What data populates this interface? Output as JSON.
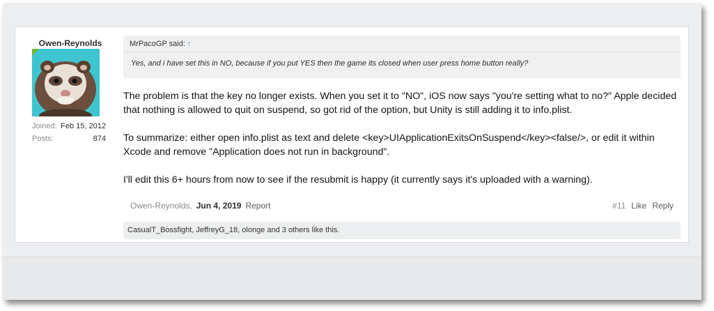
{
  "author": {
    "username": "Owen-Reynolds",
    "joined_label": "Joined:",
    "joined_value": "Feb 15, 2012",
    "posts_label": "Posts:",
    "posts_value": "874"
  },
  "quote": {
    "attribution": "MrPacoGP said:",
    "up_arrow": "↑",
    "text": "Yes, and i have set this in NO, because if you put YES then the game its closed when user press home button really?"
  },
  "message": {
    "paragraphs": [
      "The problem is that the key no longer exists. When you set it to \"NO\", iOS now says \"you're setting what to no?\" Apple decided that nothing is allowed to quit on suspend, so got rid of the option, but Unity is still adding it to info.plist.",
      "To summarize: either open info.plist as text and delete <key>UIApplicationExitsOnSuspend</key><false/>, or edit it within Xcode and remove \"Application does not run in background\".",
      "I'll edit this 6+ hours from now to see if the resubmit is happy (it currently says it's uploaded with a warning)."
    ]
  },
  "footer": {
    "author": "Owen-Reynolds,",
    "date": "Jun 4, 2019",
    "report": "Report",
    "post_number": "#11",
    "like": "Like",
    "reply": "Reply"
  },
  "likes_bar": "CasualT_Bossfight, JeffreyG_18, olonge and 3 others like this.",
  "colors": {
    "avatar_bg": "#3ec5d0",
    "online": "#70b82a",
    "link": "#4d8fd6"
  }
}
